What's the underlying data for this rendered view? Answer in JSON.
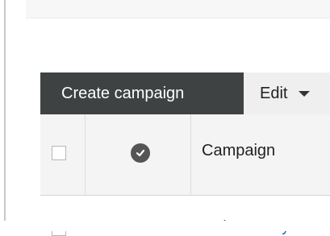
{
  "toolbar": {
    "create_label": "Create campaign",
    "edit_label": "Edit"
  },
  "table": {
    "columns": [
      "",
      "",
      "Campaign"
    ],
    "rows": [
      {
        "campaign": "make money o"
      }
    ]
  },
  "icons": {
    "status_header": "check-circle-icon",
    "edit_dropdown": "caret-down-icon",
    "row_status": "status-dash-icon"
  },
  "colors": {
    "create_button_bg": "#3f4242",
    "link": "#1a63c7"
  }
}
